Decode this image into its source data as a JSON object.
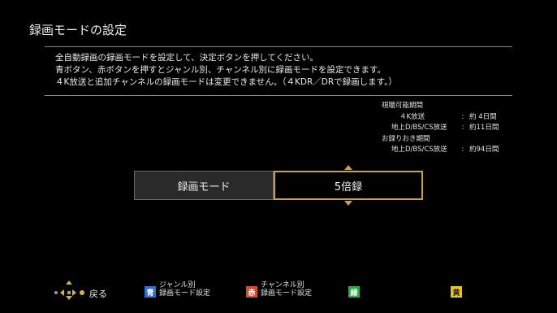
{
  "screen": {
    "title": "録画モードの設定"
  },
  "description": [
    "全自動録画の録画モードを設定して、決定ボタンを押してください。",
    "青ボタン、赤ボタンを押すとジャンル別、チャンネル別に録画モードを設定できます。",
    "４K放送と追加チャンネルの録画モードは変更できません。（４KDR／DRで録画します。）"
  ],
  "info": {
    "viewable_heading": "視聴可能期間",
    "viewable": [
      {
        "label": "４K放送",
        "value": "約 4日間"
      },
      {
        "label": "地上D/BS/CS放送",
        "value": "約11日間"
      }
    ],
    "retention_heading": "お録りおき期間",
    "retention": [
      {
        "label": "地上D/BS/CS放送",
        "value": "約94日間"
      }
    ],
    "colon": ":"
  },
  "selector": {
    "label": "録画モード",
    "value": "5倍録"
  },
  "footer": {
    "back_label": "戻る",
    "blue": {
      "glyph": "青",
      "line1": "ジャンル別",
      "line2": "録画モード設定",
      "color": "#2f6fd6"
    },
    "red": {
      "glyph": "赤",
      "line1": "チャンネル別",
      "line2": "録画モード設定",
      "color": "#d84a2a"
    },
    "green": {
      "glyph": "緑",
      "color": "#2fa84a"
    },
    "yellow": {
      "glyph": "黄",
      "color": "#e8c820"
    }
  },
  "colors": {
    "accent": "#c8a24a",
    "rule": "#8a8a8a"
  }
}
